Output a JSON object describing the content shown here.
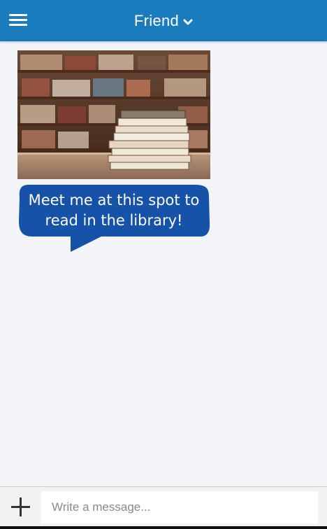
{
  "header": {
    "title": "Friend",
    "menu_icon": "hamburger-menu-icon",
    "dropdown_icon": "chevron-down-icon",
    "background_color": "#1a7bbd"
  },
  "conversation": {
    "message": {
      "image_icon": "library-books-photo",
      "text": "Meet me at this spot to read in the library!",
      "bubble_color": "#1552a8"
    }
  },
  "composer": {
    "add_icon": "plus-icon",
    "placeholder": "Write a message...",
    "value": ""
  }
}
